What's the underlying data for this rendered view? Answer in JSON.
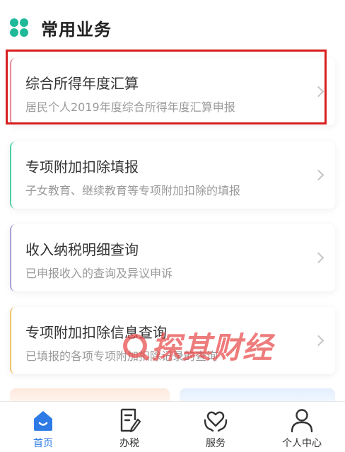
{
  "section": {
    "title": "常用业务",
    "icon": "clover-icon",
    "icon_color": "#1fb99a"
  },
  "cards": [
    {
      "title": "综合所得年度汇算",
      "desc": "居民个人2019年度综合所得年度汇算申报",
      "accent": "#e58b9a",
      "highlighted": true
    },
    {
      "title": "专项附加扣除填报",
      "desc": "子女教育、继续教育等专项附加扣除的填报",
      "accent": "#52cfa5"
    },
    {
      "title": "收入纳税明细查询",
      "desc": "已申报收入的查询及异议申诉",
      "accent": "#a7a0db"
    },
    {
      "title": "专项附加扣除信息查询",
      "desc": "已填报的各项专项附加扣除记录的查询",
      "accent": "#f0c36a"
    }
  ],
  "watermark": {
    "text": "探其财经",
    "color": "#e84a4a"
  },
  "tabbar": {
    "active_color": "#2e7be6",
    "items": [
      {
        "label": "首页",
        "icon": "home-icon",
        "active": true
      },
      {
        "label": "办税",
        "icon": "document-edit-icon",
        "active": false
      },
      {
        "label": "服务",
        "icon": "heart-hands-icon",
        "active": false
      },
      {
        "label": "个人中心",
        "icon": "person-icon",
        "active": false
      }
    ]
  },
  "highlight_color": "#d71f1f"
}
